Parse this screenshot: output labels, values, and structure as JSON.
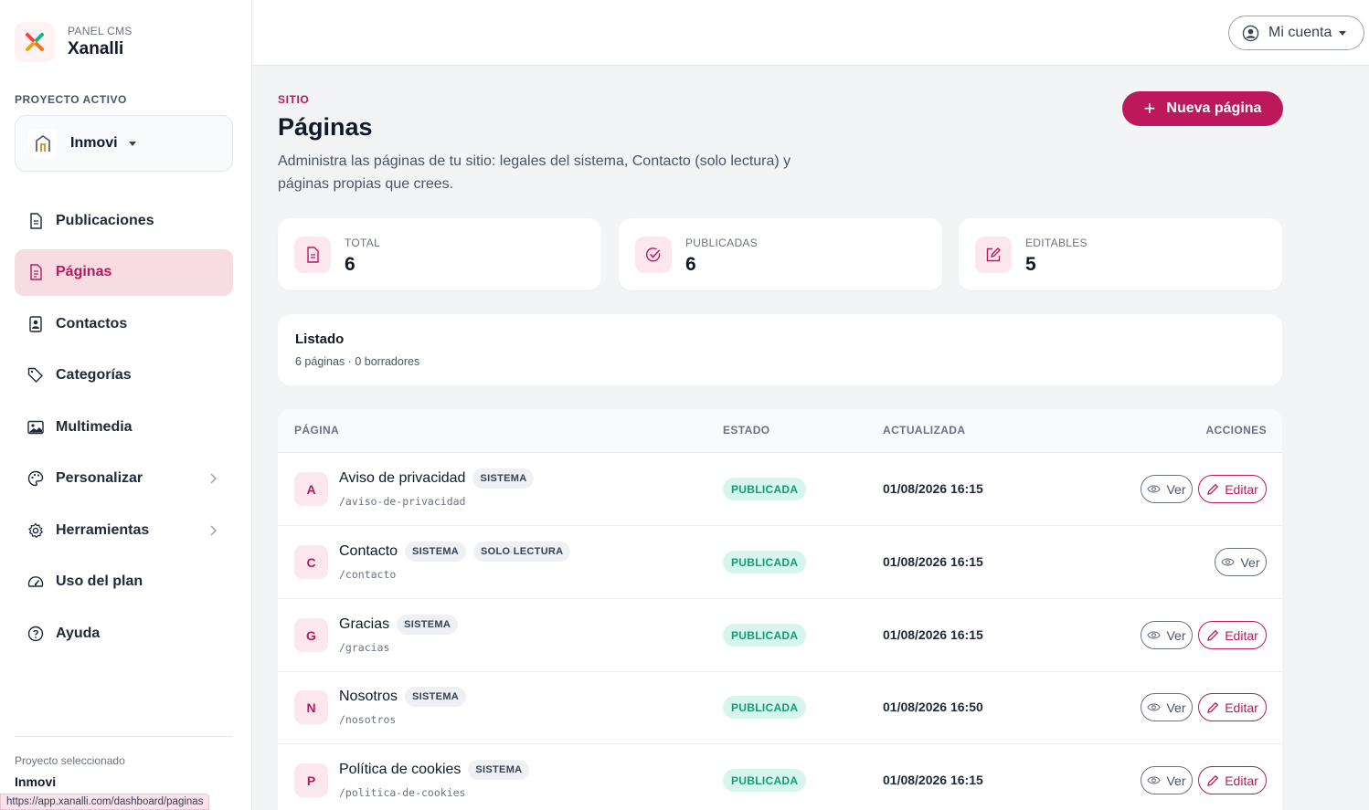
{
  "brand": {
    "sub": "PANEL CMS",
    "name": "Xanalli"
  },
  "project": {
    "label": "PROYECTO ACTIVO",
    "name": "Inmovi"
  },
  "sidebar": {
    "items": [
      {
        "label": "Publicaciones",
        "icon": "document-icon",
        "active": false
      },
      {
        "label": "Páginas",
        "icon": "page-icon",
        "active": true
      },
      {
        "label": "Contactos",
        "icon": "contact-icon",
        "active": false
      },
      {
        "label": "Categorías",
        "icon": "tags-icon",
        "active": false
      },
      {
        "label": "Multimedia",
        "icon": "image-icon",
        "active": false
      },
      {
        "label": "Personalizar",
        "icon": "palette-icon",
        "active": false,
        "chevron": true
      },
      {
        "label": "Herramientas",
        "icon": "gear-icon",
        "active": false,
        "chevron": true
      },
      {
        "label": "Uso del plan",
        "icon": "speedometer-icon",
        "active": false
      },
      {
        "label": "Ayuda",
        "icon": "help-icon",
        "active": false
      }
    ],
    "footer_label": "Proyecto seleccionado",
    "footer_value": "Inmovi"
  },
  "status_url": "https://app.xanalli.com/dashboard/paginas",
  "topbar": {
    "account_label": "Mi cuenta"
  },
  "header": {
    "section": "SITIO",
    "title": "Páginas",
    "description": "Administra las páginas de tu sitio: legales del sistema, Contacto (solo lectura) y páginas propias que crees.",
    "new_button": "Nueva página",
    "new_icon": "plus-icon"
  },
  "stats": [
    {
      "label": "TOTAL",
      "value": "6",
      "icon": "document-icon"
    },
    {
      "label": "PUBLICADAS",
      "value": "6",
      "icon": "check-circle-icon"
    },
    {
      "label": "EDITABLES",
      "value": "5",
      "icon": "edit-icon"
    }
  ],
  "listing": {
    "title": "Listado",
    "subtitle": "6 páginas · 0 borradores"
  },
  "table": {
    "columns": {
      "page": "PÁGINA",
      "status": "ESTADO",
      "updated": "ACTUALIZADA",
      "actions": "ACCIONES"
    },
    "view_label": "Ver",
    "edit_label": "Editar",
    "rows": [
      {
        "initial": "A",
        "title": "Aviso de privacidad",
        "tags": [
          "SISTEMA"
        ],
        "slug": "/aviso-de-privacidad",
        "status": "PUBLICADA",
        "updated": "01/08/2026 16:15",
        "editable": true
      },
      {
        "initial": "C",
        "title": "Contacto",
        "tags": [
          "SISTEMA",
          "SOLO LECTURA"
        ],
        "slug": "/contacto",
        "status": "PUBLICADA",
        "updated": "01/08/2026 16:15",
        "editable": false
      },
      {
        "initial": "G",
        "title": "Gracias",
        "tags": [
          "SISTEMA"
        ],
        "slug": "/gracias",
        "status": "PUBLICADA",
        "updated": "01/08/2026 16:15",
        "editable": true
      },
      {
        "initial": "N",
        "title": "Nosotros",
        "tags": [
          "SISTEMA"
        ],
        "slug": "/nosotros",
        "status": "PUBLICADA",
        "updated": "01/08/2026 16:50",
        "editable": true
      },
      {
        "initial": "P",
        "title": "Política de cookies",
        "tags": [
          "SISTEMA"
        ],
        "slug": "/politica-de-cookies",
        "status": "PUBLICADA",
        "updated": "01/08/2026 16:15",
        "editable": true
      }
    ]
  },
  "colors": {
    "accent": "#be185d",
    "accent_soft": "#f7dce4",
    "success": "#0f9f76",
    "success_soft": "#d6f5ec"
  }
}
